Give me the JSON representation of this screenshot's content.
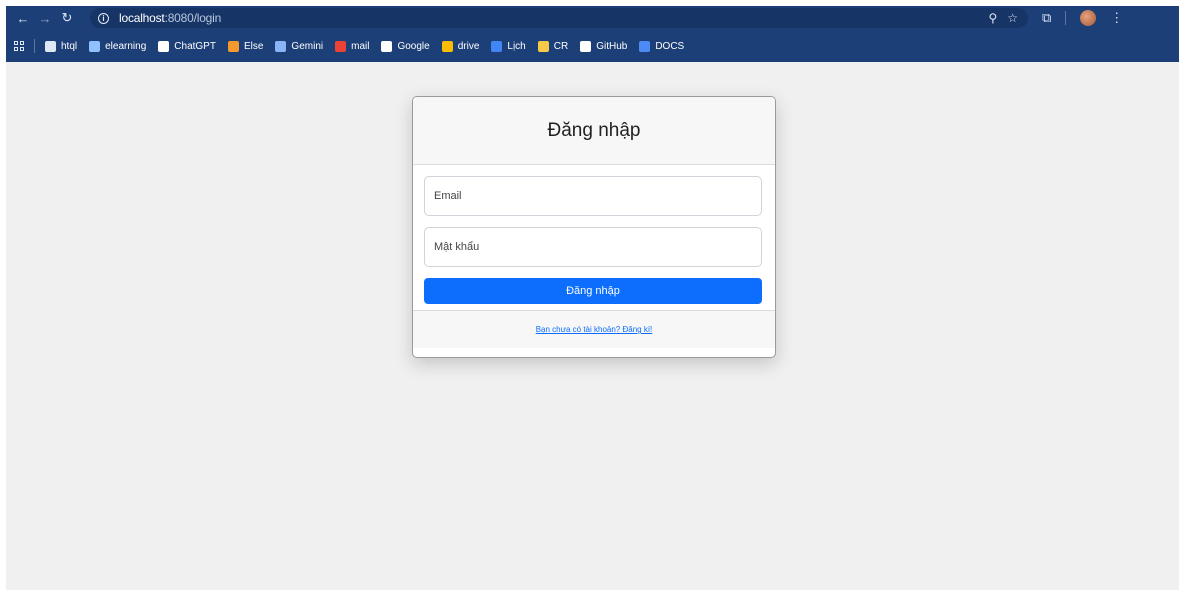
{
  "browser": {
    "url_host": "localhost",
    "url_path": ":8080/login",
    "colors": {
      "toolbar": "#1d3f77",
      "accent": "#0d6efd"
    },
    "icons": {
      "back": "back-arrow-icon",
      "forward": "forward-arrow-icon",
      "reload": "reload-icon",
      "info": "info-icon",
      "zoom": "zoom-icon",
      "star": "star-icon",
      "extensions": "extensions-icon",
      "menu": "kebab-menu-icon"
    }
  },
  "bookmarks": [
    {
      "label": "htql",
      "icon_color": "#dfe7f5"
    },
    {
      "label": "elearning",
      "icon_color": "#8fc1ff"
    },
    {
      "label": "ChatGPT",
      "icon_color": "#ffffff"
    },
    {
      "label": "Else",
      "icon_color": "#f29a2e"
    },
    {
      "label": "Gemini",
      "icon_color": "#8ab4f8"
    },
    {
      "label": "mail",
      "icon_color": "#ea4335"
    },
    {
      "label": "Google",
      "icon_color": "#ffffff"
    },
    {
      "label": "drive",
      "icon_color": "#fbbc04"
    },
    {
      "label": "Lịch",
      "icon_color": "#4285f4"
    },
    {
      "label": "CR",
      "icon_color": "#f7c948"
    },
    {
      "label": "GitHub",
      "icon_color": "#ffffff"
    },
    {
      "label": "DOCS",
      "icon_color": "#4c8bf5"
    }
  ],
  "login": {
    "title": "Đăng nhập",
    "email_placeholder": "Email",
    "password_placeholder": "Mật khẩu",
    "submit_label": "Đăng nhập",
    "register_link": "Bạn chưa có tài khoản? Đăng kí!"
  }
}
